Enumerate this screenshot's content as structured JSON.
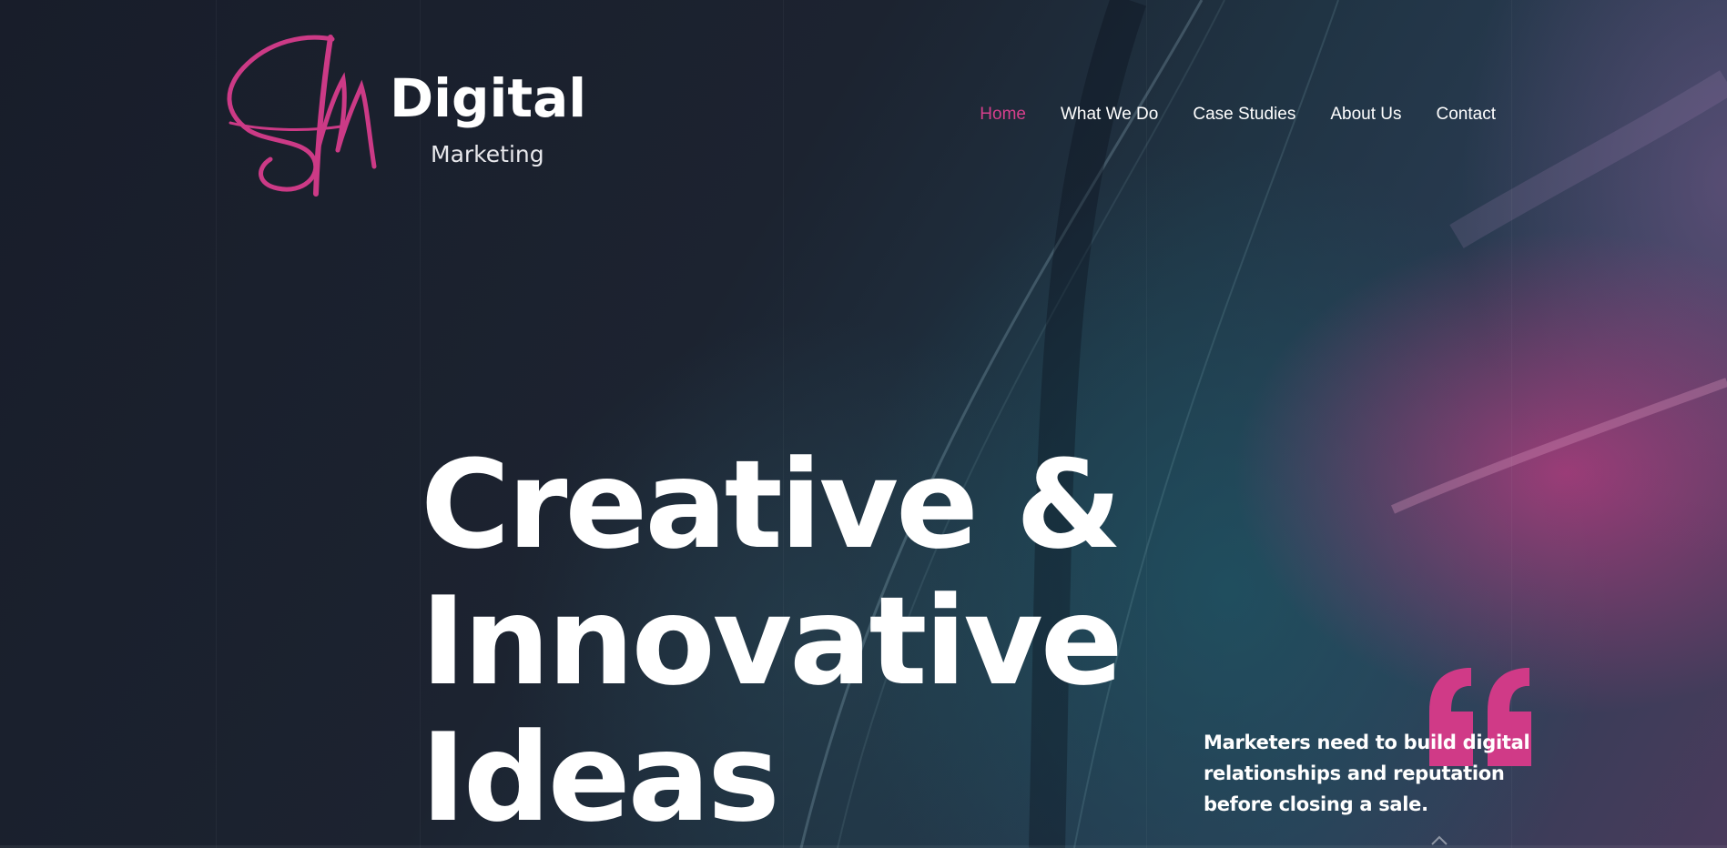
{
  "brand": {
    "name": "Digital",
    "tagline": "Marketing",
    "signature": "SM",
    "accent_color": "#d63f8c"
  },
  "nav": {
    "items": [
      {
        "label": "Home",
        "active": true
      },
      {
        "label": "What We Do",
        "active": false
      },
      {
        "label": "Case Studies",
        "active": false
      },
      {
        "label": "About Us",
        "active": false
      },
      {
        "label": "Contact",
        "active": false
      }
    ]
  },
  "hero": {
    "headline_lines": [
      "Creative &",
      "Innovative",
      "Ideas"
    ],
    "quote_icon": "quote-mark-icon",
    "quote": "Marketers need to build digital relationships and reputation before closing a sale."
  }
}
